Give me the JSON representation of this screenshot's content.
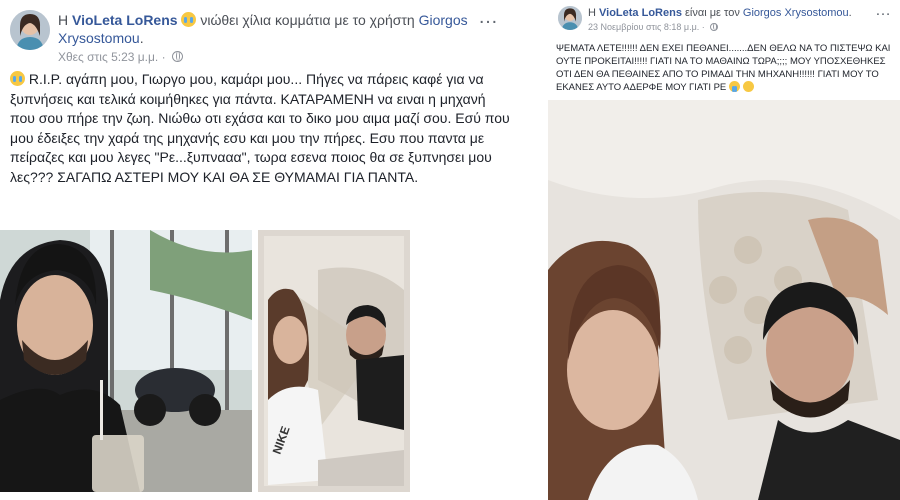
{
  "left_post": {
    "author_prefix": "Η",
    "author": "VioLeta LoRens",
    "feeling": "νιώθει χίλια κομμάτια με το χρήστη",
    "tagged": "Giorgos Xrysostomou",
    "tagged_suffix": ".",
    "timestamp": "Χθες στις 5:23 μ.μ.",
    "more_icon": "…",
    "text": "R.I.P. αγάπη μου, Γιωργο μου, καμάρι μου... Πήγες να πάρεις καφέ για να ξυπνήσεις και τελικά κοιμήθηκες για πάντα. ΚΑΤΑΡΑΜΕΝΗ να ειναι η μηχανή που σου πήρε την ζωη. Νιώθω οτι εχάσα και το δικο μου αιμα μαζί σου. Εσύ που μου έδειξες την χαρά της μηχανής εσυ και μου την πήρες. Εσυ που παντα με πείραζες και μου λεγες \"Ρε...ξυπνααα\", τωρα εσενα ποιος θα σε ξυπνησει μου λες??? ΣΑΓΑΠΩ ΑΣΤΕΡΙ ΜΟΥ ΚΑΙ ΘΑ ΣΕ ΘΥΜΑΜΑΙ ΓΙΑ ΠΑΝΤΑ."
  },
  "right_post": {
    "author_prefix": "Η",
    "author": "VioLeta LoRens",
    "with_text": "είναι με τον",
    "tagged": "Giorgos Xrysostomou",
    "tagged_suffix": ".",
    "timestamp": "23 Νοεμβρίου στις 8:18 μ.μ.",
    "more_icon": "…",
    "text": "ΨΕΜΑΤΑ ΛΕΤΕ!!!!!! ΔΕΝ ΕΧΕΙ ΠΕΘΑΝΕΙ.......ΔΕΝ ΘΕΛΩ ΝΑ ΤΟ ΠΙΣΤΕΨΩ ΚΑΙ ΟΥΤΕ ΠΡΟΚΕΙΤΑΙ!!!!! ΓΙΑΤΙ ΝΑ ΤΟ ΜΑΘΑΙΝΩ ΤΩΡΑ;;;; ΜΟΥ ΥΠΟΣΧΕΘΗΚΕΣ ΟΤΙ ΔΕΝ ΘΑ ΠΕΘΑΙΝΕΣ ΑΠΟ ΤΟ ΡΙΜΑΔΙ ΤΗΝ ΜΗΧΑΝΗ!!!!!! ΓΙΑΤΙ ΜΟΥ ΤΟ ΕΚΑΝΕΣ ΑΥΤΟ ΑΔΕΡΦΕ ΜΟΥ ΓΙΑΤΙ ΡΕ"
  },
  "colors": {
    "link": "#365899",
    "meta": "#90949c",
    "text": "#1d2129"
  }
}
